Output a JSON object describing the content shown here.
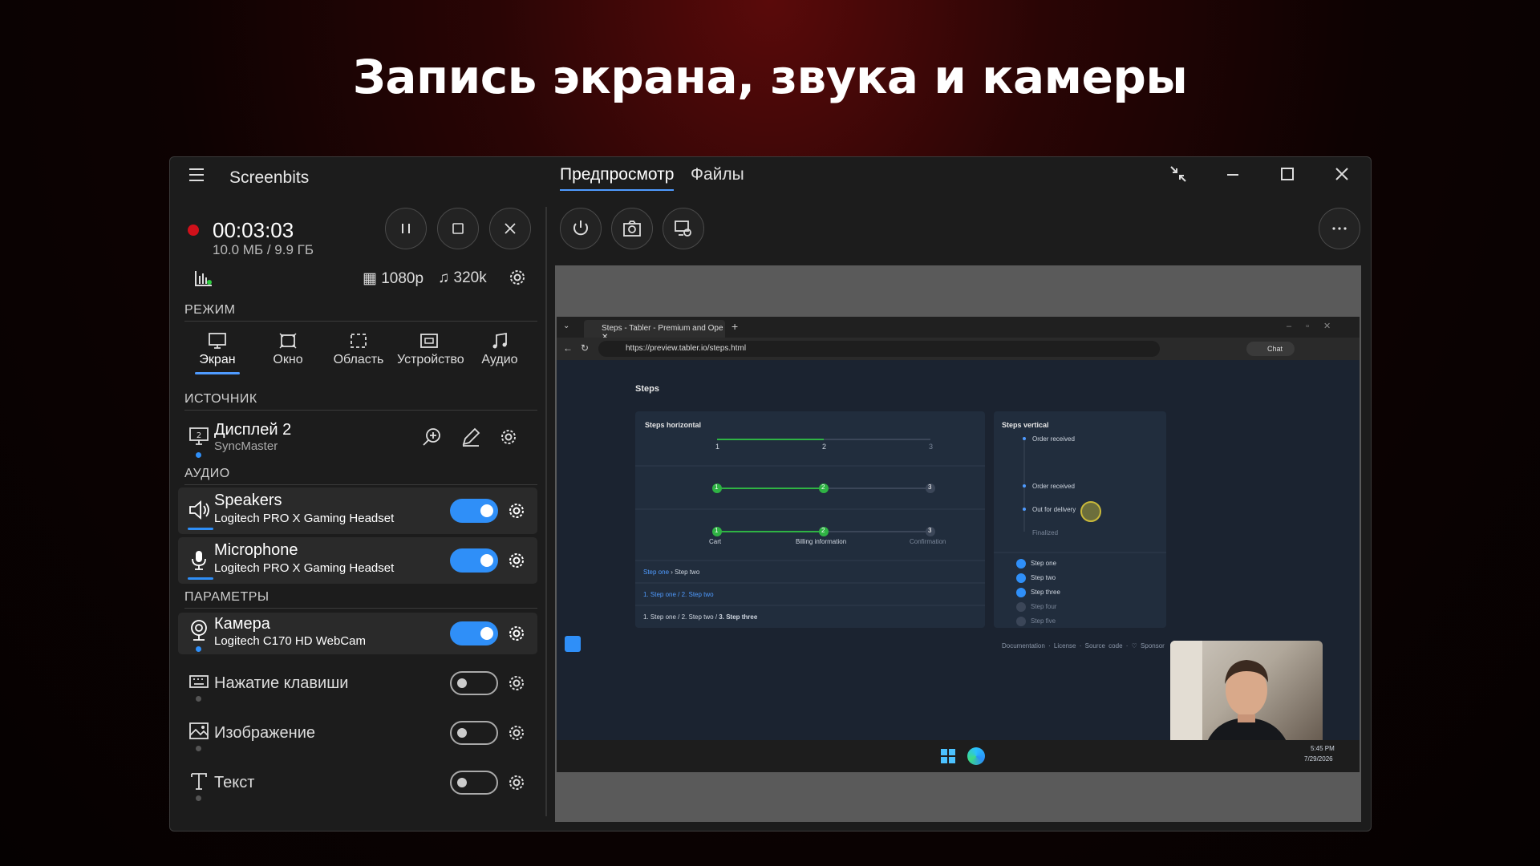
{
  "headline": "Запись экрана, звука и камеры",
  "app": {
    "title": "Screenbits"
  },
  "tabs": [
    "Предпросмотр",
    "Файлы"
  ],
  "recording": {
    "timer": "00:03:03",
    "size": "10.0 МБ / 9.9 ГБ"
  },
  "format": {
    "resolution": "1080p",
    "bitrate": "320k"
  },
  "sections": {
    "mode": "РЕЖИМ",
    "source": "ИСТОЧНИК",
    "audio": "АУДИО",
    "params": "ПАРАМЕТРЫ"
  },
  "modes": [
    "Экран",
    "Окно",
    "Область",
    "Устройство",
    "Аудио"
  ],
  "source": {
    "name": "Дисплей 2",
    "sub": "SyncMaster"
  },
  "audio": [
    {
      "name": "Speakers",
      "device": "Logitech PRO X Gaming Headset",
      "on": true
    },
    {
      "name": "Microphone",
      "device": "Logitech PRO X Gaming Headset",
      "on": true
    }
  ],
  "params": [
    {
      "name": "Камера",
      "device": "Logitech C170 HD WebCam",
      "on": true
    },
    {
      "name": "Нажатие клавиши",
      "on": false
    },
    {
      "name": "Изображение",
      "on": false
    },
    {
      "name": "Текст",
      "on": false
    }
  ],
  "browser": {
    "tab": "Steps - Tabler - Premium and Ope",
    "url": "https://preview.tabler.io/steps.html",
    "chat": "Chat",
    "page_title": "Steps",
    "card1_title": "Steps horizontal",
    "card2_title": "Steps vertical",
    "h_labels": [
      "1",
      "2",
      "3"
    ],
    "h_named": [
      "Cart",
      "Billing information",
      "Confirmation"
    ],
    "breadcrumbs": [
      "Step one",
      "Step two"
    ],
    "breadcrumbs2": [
      "1. Step one",
      "2. Step two"
    ],
    "breadcrumbs3": [
      "1. Step one",
      "2. Step two",
      "3. Step three"
    ],
    "vertical": [
      "Order received",
      "Order received",
      "Out for delivery",
      "Finalized"
    ],
    "numbered": [
      "Step one",
      "Step two",
      "Step three",
      "Step four",
      "Step five"
    ],
    "footer": [
      "Documentation",
      "License",
      "Source code",
      "Sponsor"
    ],
    "time": "5:45 PM",
    "date": "7/29/2026"
  }
}
